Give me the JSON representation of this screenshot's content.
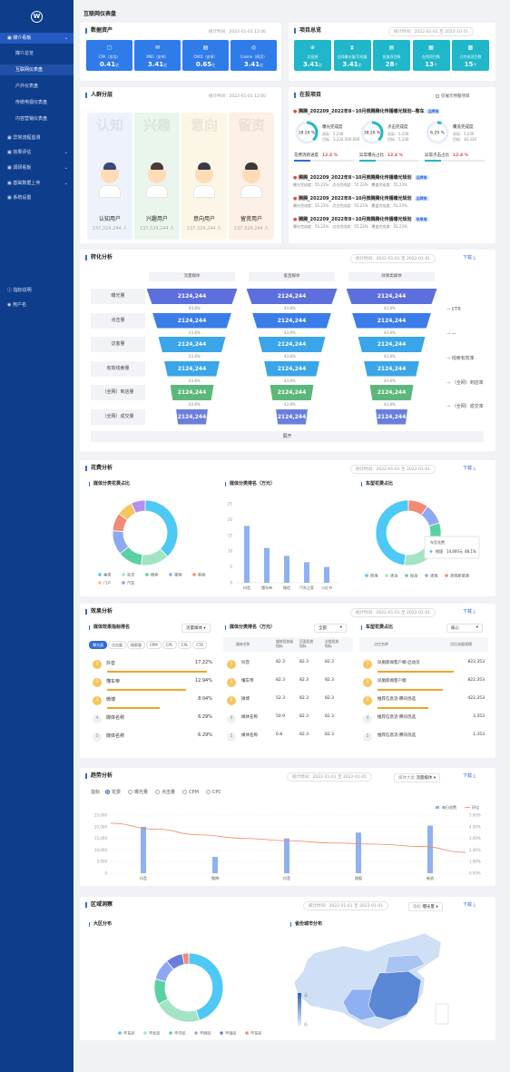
{
  "sidebar": {
    "items": [
      {
        "label": "媒介看板",
        "level": 0,
        "active": true
      },
      {
        "label": "媒介总览",
        "level": 1
      },
      {
        "label": "互联网仪表盘",
        "level": 1,
        "active": true
      },
      {
        "label": "户外仪表盘",
        "level": 1
      },
      {
        "label": "传统电视仪表盘",
        "level": 1
      },
      {
        "label": "内容营销仪表盘",
        "level": 1
      },
      {
        "label": "异常流程监测",
        "level": 0
      },
      {
        "label": "效果评估",
        "level": 0
      },
      {
        "label": "调研看板",
        "level": 0
      },
      {
        "label": "基础数据上传",
        "level": 0
      },
      {
        "label": "系统设置",
        "level": 0
      }
    ],
    "bottom": [
      {
        "label": "指标说明"
      },
      {
        "label": "用户名"
      }
    ]
  },
  "page": {
    "title": "互联网仪表盘"
  },
  "assets": {
    "title": "数据资产",
    "date": "统计时间：2022-01-01 12:00",
    "kpis": [
      {
        "name": "CPA（次均）",
        "value": "0.41",
        "unit": "亿",
        "color": "#2f7be8"
      },
      {
        "name": "IMEI（安卓）",
        "value": "3.41",
        "unit": "亿",
        "color": "#2f7be8"
      },
      {
        "name": "OAID（安卓）",
        "value": "0.65",
        "unit": "亿",
        "color": "#2f7be8"
      },
      {
        "name": "Cookie（网页）",
        "value": "3.41",
        "unit": "亿",
        "color": "#2f7be8"
      }
    ]
  },
  "projects": {
    "title": "项目总览",
    "date": "统计时间：2022-01-01 至 2022-10-11",
    "kpis": [
      {
        "name": "总投放",
        "value": "3.41",
        "unit": "亿"
      },
      {
        "name": "全网曝光量/可视量",
        "value": "3.41",
        "unit": "亿"
      },
      {
        "name": "投放项目数",
        "value": "28",
        "unit": "个"
      },
      {
        "name": "在投项目数",
        "value": "13",
        "unit": "个"
      },
      {
        "name": "已完成项目数",
        "value": "15",
        "unit": "个"
      }
    ]
  },
  "crowd": {
    "title": "人群分层",
    "date": "统计时间：2022-01-01 12:00",
    "groups": [
      {
        "big": "认知",
        "label": "认知用户",
        "value": "137,324,244 人",
        "bg": "#eef3fb"
      },
      {
        "big": "兴趣",
        "label": "兴趣用户",
        "value": "137,324,244 人",
        "bg": "#eaf6ec"
      },
      {
        "big": "意向",
        "label": "意向用户",
        "value": "137,324,244 人",
        "bg": "#fbf6e6"
      },
      {
        "big": "留资",
        "label": "留资用户",
        "value": "137,324,244 人",
        "bg": "#fdf0e6"
      }
    ]
  },
  "active": {
    "title": "在投项目",
    "warn": "仅展示预警项目",
    "main": {
      "name": "腾腾_202209_2022年8~10月推腾腾化传播曝光规划--整车",
      "tag": "品牌推",
      "rings": [
        {
          "pct": "38.26 %",
          "t": "曝光完成度",
          "a": "实际：5,230",
          "b": "目标：3,232,500,000"
        },
        {
          "pct": "38.26 %",
          "t": "点击完成度",
          "a": "实际：5,230",
          "b": "目标：5,230"
        },
        {
          "pct": "6.29 %",
          "t": "覆盖完成度",
          "a": "实际：5,230",
          "b": "目标：10,330"
        }
      ],
      "bars": [
        {
          "t": "花费消耗进度",
          "v": "12.4 %"
        },
        {
          "t": "异常曝光占比",
          "v": "12.4 %"
        },
        {
          "t": "异常点击占比",
          "v": "12.4 %"
        }
      ]
    },
    "list": [
      {
        "name": "腾腾_202209_2022年8~10月推腾腾化传播曝光规划",
        "tag": "品牌推",
        "l1": "曝光完成度：55.23%　点击完成度：55.23%　覆盖完成度：55.23%"
      },
      {
        "name": "腾腾_202209_2022年8~10月推腾腾化传播曝光规划",
        "tag": "品牌推",
        "l1": "曝光完成度：55.23%　点击完成度：55.23%　覆盖完成度：55.23%"
      },
      {
        "name": "腾腾_202209_2022年8~10月推腾腾化传播曝光规划",
        "tag": "效果推",
        "l1": "曝光完成度：55.23%　点击完成度：55.23%　覆盖完成度：55.23%"
      }
    ]
  },
  "funnel": {
    "title": "转化分析",
    "date": "统计时间：2022-01-01 至 2022-01-01",
    "download": "下载",
    "cols": [
      "流量媒体",
      "垂直媒体",
      "效果类媒体"
    ],
    "stages": [
      "曝光量",
      "点击量",
      "访客量",
      "有效线索量",
      "（全网）到店量",
      "（全网）成交量"
    ],
    "value": "2124,244",
    "pct": "43.8%",
    "right": [
      "CTR",
      "—",
      "线索有效率",
      "（全网）到店率",
      "（全网）成交率"
    ],
    "expand": "展开"
  },
  "spend": {
    "title": "花费分析",
    "date": "统计时间：2022-01-01 至 2022-01-01",
    "download": "下载",
    "pie1": {
      "title": "媒体分类花费占比",
      "legend": [
        "垂类",
        "社交",
        "搜索",
        "视频",
        "新闻",
        "门户",
        "汽车"
      ]
    },
    "bar": {
      "title": "媒体分类排名（万元）",
      "yticks": [
        "25",
        "20",
        "15",
        "10",
        "5",
        "0"
      ],
      "cats": [
        "抖音",
        "懂车帝",
        "微信",
        "汽车之家",
        "小红书"
      ],
      "vals": [
        18,
        11,
        8.5,
        6.5,
        5
      ]
    },
    "pie2": {
      "title": "车型花费占比",
      "legend": [
        "揽境",
        "途岳",
        "探岳",
        "途观",
        "途观新能源"
      ],
      "tip1": "车型花费",
      "tip2": "揽境",
      "tip3": "14,600元",
      "tip4": "48.1%"
    }
  },
  "effect": {
    "title": "效果分析",
    "date": "统计时间：2022-01-01 至 2022-01-01",
    "download": "下载",
    "a": {
      "title": "媒体效果指标排名",
      "sel": "流量媒体",
      "tabs": [
        "曝光量",
        "点击量",
        "搜索量",
        "CPM",
        "CPC",
        "CPL",
        "CTR"
      ],
      "rows": [
        {
          "r": "1",
          "n": "抖音",
          "v": "17.22%",
          "w": 0.95
        },
        {
          "r": "2",
          "n": "懂车帝",
          "v": "12.94%",
          "w": 0.75
        },
        {
          "r": "3",
          "n": "微博",
          "v": "8.04%",
          "w": 0.5
        },
        {
          "r": "4",
          "n": "媒体名称",
          "v": "6.29%",
          "w": 0
        },
        {
          "r": "5",
          "n": "媒体名称",
          "v": "6.29%",
          "w": 0
        }
      ]
    },
    "b": {
      "title": "媒体分类排名（万元）",
      "sel": "全部",
      "head": [
        "媒体名称",
        "媒体投放量\n指标",
        "页面投放\n指标",
        "全链投放\n指标"
      ],
      "rows": [
        {
          "r": "1",
          "n": "抖音",
          "v": [
            "82.3",
            "82.3",
            "82.3"
          ]
        },
        {
          "r": "2",
          "n": "懂车帝",
          "v": [
            "82.3",
            "82.3",
            "82.3"
          ]
        },
        {
          "r": "3",
          "n": "微博",
          "v": [
            "52.3",
            "82.3",
            "82.3"
          ]
        },
        {
          "r": "4",
          "n": "媒体名称",
          "v": [
            "50.9",
            "82.3",
            "82.3"
          ]
        },
        {
          "r": "5",
          "n": "媒体名称",
          "v": [
            "6.8",
            "82.3",
            "82.3"
          ]
        }
      ]
    },
    "c": {
      "title": "车型花费占比",
      "sel": "核心",
      "head": [
        "点位名称",
        "点位流量规模"
      ],
      "rows": [
        {
          "r": "1",
          "n": "凤凰新闻客户端-启动页",
          "v": "822,353"
        },
        {
          "r": "2",
          "n": "凤凰新闻客户端",
          "v": "822,353"
        },
        {
          "r": "3",
          "n": "推荐信息流-腾讯优选",
          "v": "422,353"
        },
        {
          "r": "4",
          "n": "推荐信息流-腾讯优选",
          "v": "3,353"
        },
        {
          "r": "5",
          "n": "推荐信息流-腾讯优选",
          "v": "1,353"
        }
      ]
    }
  },
  "trend": {
    "title": "趋势分析",
    "date": "统计时间：2022-01-01 至 2022-01-01",
    "dim": "媒体大类",
    "dimv": "流量媒体",
    "download": "下载",
    "metric": "指标",
    "radios": [
      "花费",
      "曝光量",
      "点击量",
      "CPM",
      "CPC"
    ],
    "legend": [
      "每日花费",
      "环比"
    ],
    "yl": [
      "25,000",
      "20,000",
      "15,000",
      "10,000",
      "5,000",
      "0"
    ],
    "yr": [
      "5.00%",
      "4.00%",
      "3.00%",
      "2.00%",
      "1.00%",
      "0.00%"
    ],
    "cats": [
      "抖音",
      "微博",
      "抖音",
      "搜狐",
      "新浪"
    ],
    "bars": [
      20000,
      7000,
      15000,
      17500,
      20500
    ],
    "line": [
      4.3,
      3.8,
      3.3,
      3.0,
      2.8,
      2.6,
      2.5,
      2.3,
      1.8
    ]
  },
  "region": {
    "title": "区域洞察",
    "date": "统计时间：2022-01-01 至 2022-01-01",
    "metric": "指标",
    "metricv": "曝光量",
    "download": "下载",
    "pie": {
      "title": "大区分布",
      "legend": [
        "华东区",
        "华北区",
        "华中区",
        "华西区",
        "华南区",
        "华东区"
      ]
    },
    "map": {
      "title": "省份城市分布",
      "hi": "高",
      "lo": "低"
    }
  },
  "colors": {
    "p1": [
      "#4ec8f5",
      "#a3e4c4",
      "#5bd1a3",
      "#8fa8f4",
      "#f38a75",
      "#f5c65f",
      "#b58ef0"
    ],
    "p2": [
      "#4ec8f5",
      "#a3e4c4",
      "#5bd1a3",
      "#8fa8f4",
      "#f38a75"
    ]
  }
}
